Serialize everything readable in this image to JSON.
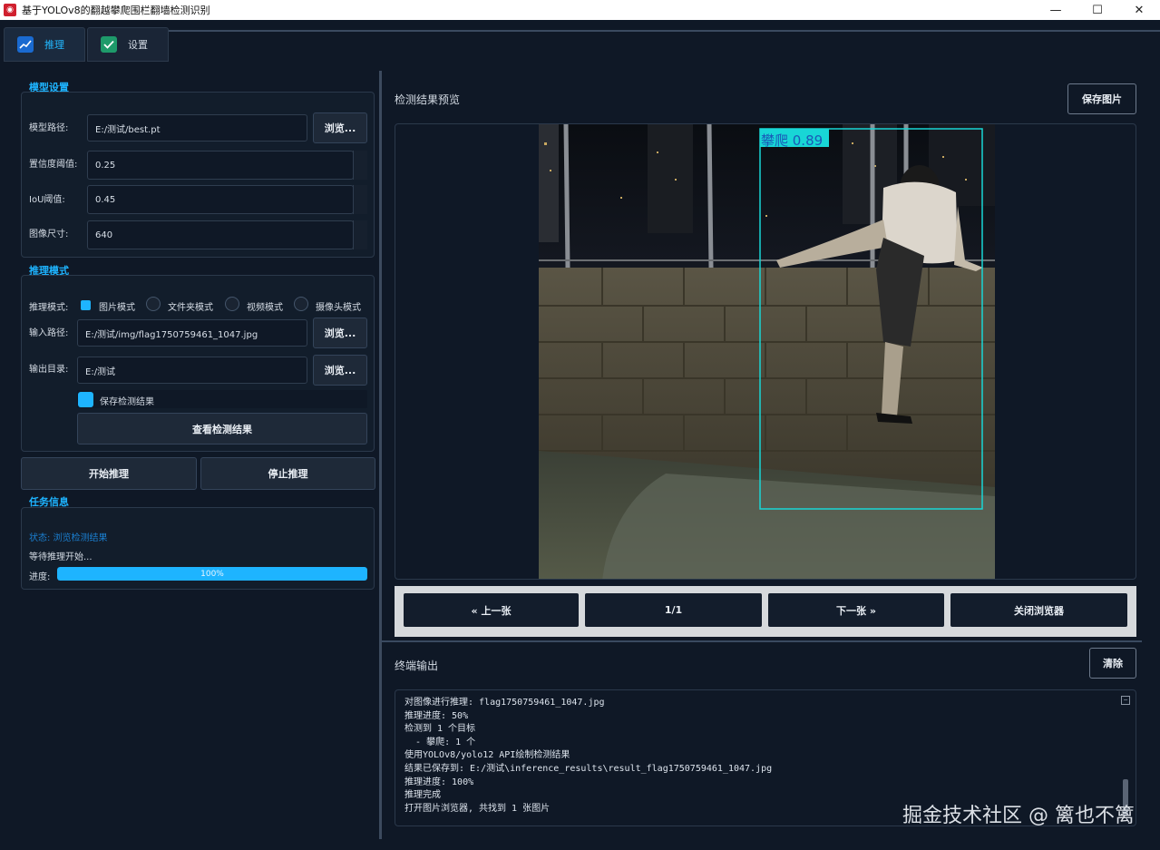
{
  "window": {
    "title": "基于YOLOv8的翻越攀爬围栏翻墙检测识别",
    "minimize": "—",
    "maximize": "☐",
    "close": "✕"
  },
  "tabs": [
    {
      "label": "推理",
      "icon": "chart-icon"
    },
    {
      "label": "设置",
      "icon": "check-icon"
    }
  ],
  "model_settings": {
    "title": "模型设置",
    "model_path_label": "模型路径:",
    "model_path": "E:/测试/best.pt",
    "browse_label": "浏览...",
    "confidence_label": "置信度阈值:",
    "confidence": "0.25",
    "iou_label": "IoU阈值:",
    "iou": "0.45",
    "imgsize_label": "图像尺寸:",
    "imgsize": "640"
  },
  "inference_mode": {
    "title": "推理模式",
    "mode_label": "推理模式:",
    "modes": [
      "图片模式",
      "文件夹模式",
      "视频模式",
      "摄像头模式"
    ],
    "selected_mode": "图片模式",
    "input_label": "输入路径:",
    "input_path": "E:/测试/img/flag1750759461_1047.jpg",
    "output_label": "输出目录:",
    "output_path": "E:/测试",
    "browse_label": "浏览...",
    "save_results_label": "保存检测结果",
    "save_results_checked": true,
    "view_results_label": "查看检测结果"
  },
  "actions": {
    "start_label": "开始推理",
    "stop_label": "停止推理"
  },
  "task_info": {
    "title": "任务信息",
    "status": "状态: 浏览检测结果",
    "message": "等待推理开始...",
    "progress_label": "进度:",
    "progress_value": 100,
    "progress_text": "100%"
  },
  "preview": {
    "title": "检测结果预览",
    "save_image_label": "保存图片",
    "detection_label": "攀爬 0.89",
    "box_color": "#18d6d6"
  },
  "browser_nav": {
    "prev_label": "« 上一张",
    "counter": "1/1",
    "next_label": "下一张 »",
    "close_label": "关闭浏览器"
  },
  "terminal": {
    "title": "终端输出",
    "clear_label": "清除",
    "lines": [
      "对图像进行推理: flag1750759461_1047.jpg",
      "推理进度: 50%",
      "检测到 1 个目标",
      "  - 攀爬: 1 个",
      "使用YOLOv8/yolo12 API绘制检测结果",
      "结果已保存到: E:/测试\\inference_results\\result_flag1750759461_1047.jpg",
      "推理进度: 100%",
      "推理完成",
      "打开图片浏览器, 共找到 1 张图片"
    ]
  },
  "watermark": "掘金技术社区 @ 篱也不篱",
  "colors": {
    "accent": "#1eb4ff",
    "background": "#0f1826",
    "panel": "#121d2b"
  }
}
